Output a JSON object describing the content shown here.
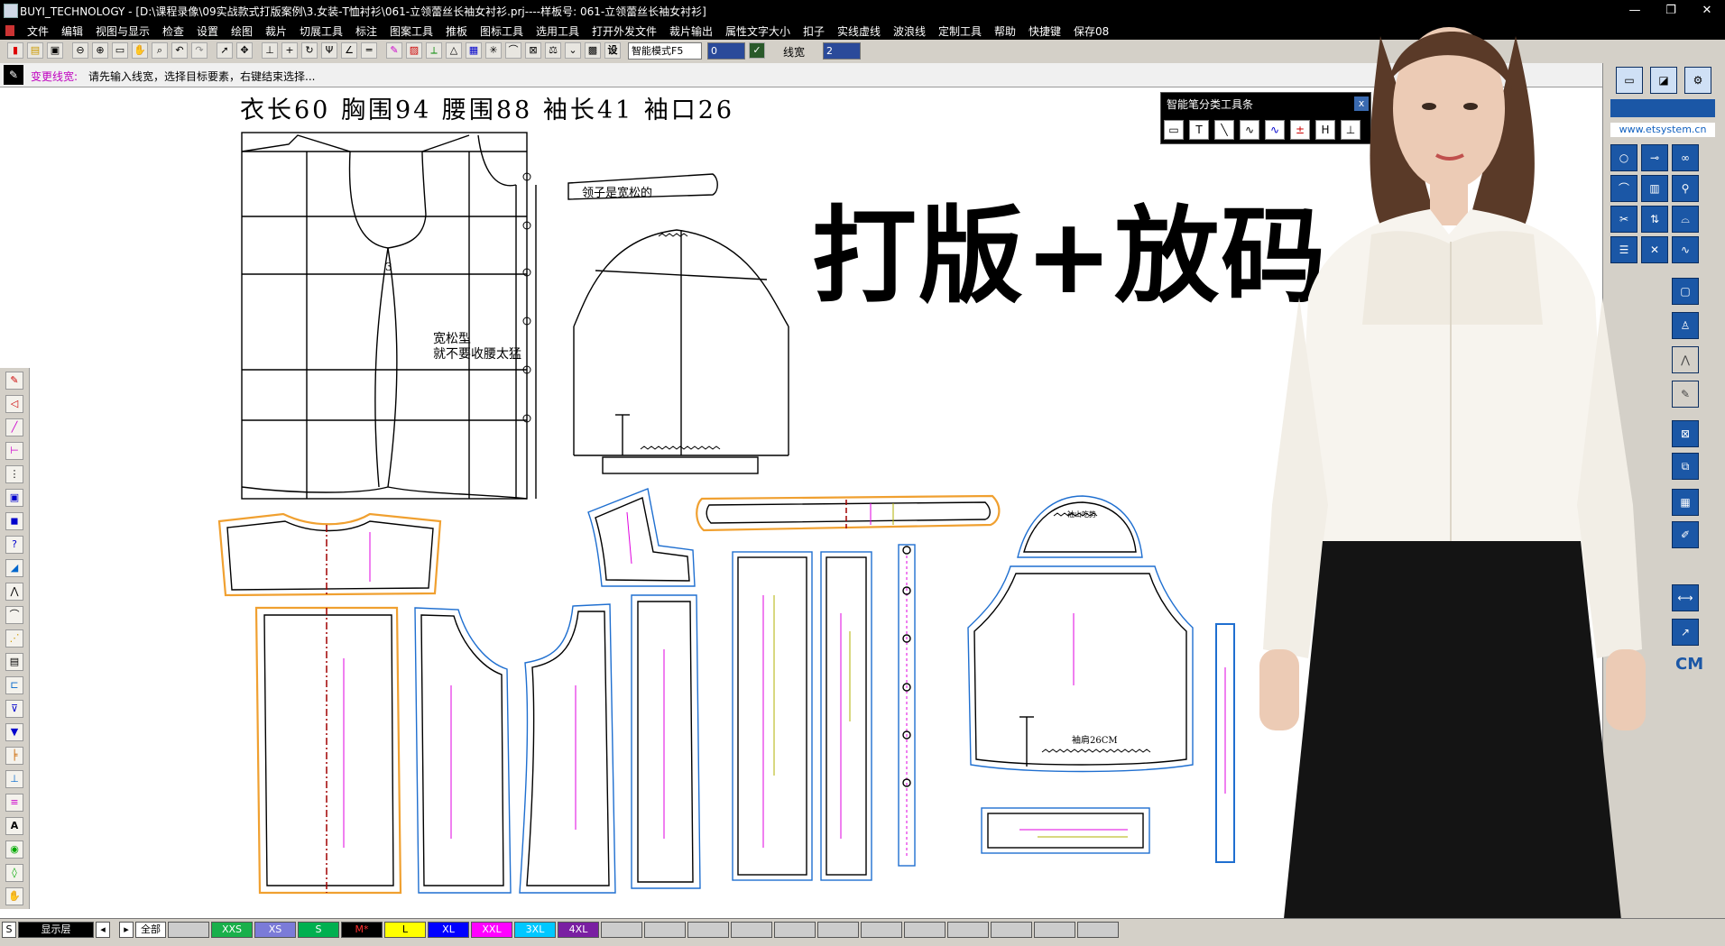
{
  "titlebar": {
    "title": "BUYI_TECHNOLOGY - [D:\\课程录像\\09实战款式打版案例\\3.女装-T恤衬衫\\061-立领蕾丝长袖女衬衫.prj----样板号: 061-立领蕾丝长袖女衬衫]"
  },
  "menu": [
    "文件",
    "编辑",
    "视图与显示",
    "检查",
    "设置",
    "绘图",
    "裁片",
    "切展工具",
    "标注",
    "图案工具",
    "推板",
    "图标工具",
    "选用工具",
    "打开外发文件",
    "裁片输出",
    "属性文字大小",
    "扣子",
    "实线虚线",
    "波浪线",
    "定制工具",
    "帮助",
    "快捷键",
    "保存08"
  ],
  "toolbar": {
    "mode_select": "智能模式F5",
    "input_value": "0",
    "linewidth_label": "线宽",
    "linewidth_value": "2"
  },
  "prompt": {
    "label": "变更线宽:",
    "text": "请先输入线宽，选择目标要素，右键结束选择..."
  },
  "smartpen": {
    "title": "智能笔分类工具条",
    "close": "x",
    "buttons": [
      "▭",
      "T",
      "╲",
      "∿",
      "∿",
      "±",
      "H",
      "⊥"
    ]
  },
  "canvas": {
    "measurements": "衣长60  胸围94  腰围88  袖长41  袖口26",
    "collar_note": "领子是宽松的",
    "loose_note_1": "宽松型",
    "loose_note_2": "就不要收腰太猛",
    "dart_number": "3",
    "sleeve_note": "袖肩26CM",
    "sleeve_top_note": "袖山吃势",
    "big_title": "打版+放码"
  },
  "rightpanel": {
    "site": "www.etsystem.cn",
    "cm_label": "CM"
  },
  "statusbar": {
    "s_label": "S",
    "layer_label": "显示层",
    "all_label": "全部",
    "sizes": [
      {
        "name": "XXS",
        "color": "#19b04b"
      },
      {
        "name": "XS",
        "color": "#7b7bd8"
      },
      {
        "name": "S",
        "color": "#00b050"
      },
      {
        "name": "M*",
        "color": "#c00000"
      },
      {
        "name": "L",
        "color": "#ffff00"
      },
      {
        "name": "XL",
        "color": "#0000ff"
      },
      {
        "name": "XXL",
        "color": "#ff00ff"
      },
      {
        "name": "3XL",
        "color": "#00c8ff"
      },
      {
        "name": "4XL",
        "color": "#7a1fa2"
      }
    ]
  },
  "colors": {
    "outline_blue": "#1f6fd0",
    "outline_orange": "#f0a030",
    "grainline_magenta": "#e000e0",
    "grainline_olive": "#b0b000",
    "notch_green": "#19a019",
    "center_red": "#a00000"
  }
}
